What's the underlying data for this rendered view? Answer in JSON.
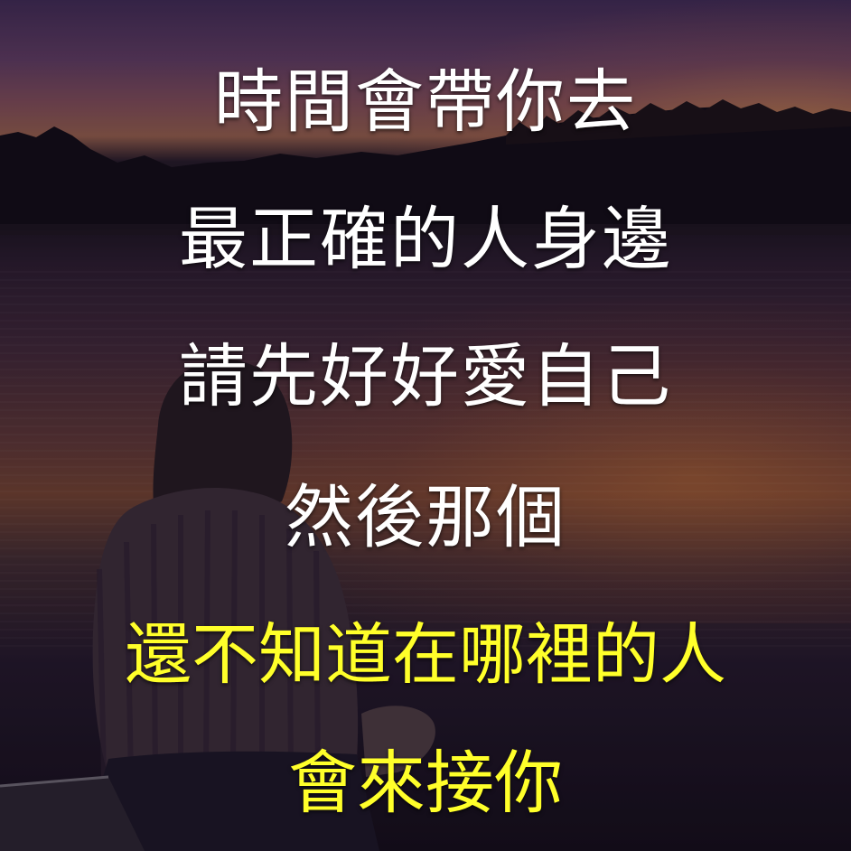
{
  "quote": {
    "lines": [
      {
        "text": "時間會帶你去",
        "color": "#ffffff"
      },
      {
        "text": "最正確的人身邊",
        "color": "#ffffff"
      },
      {
        "text": "請先好好愛自己",
        "color": "#ffffff"
      },
      {
        "text": "然後那個",
        "color": "#ffffff"
      },
      {
        "text": "還不知道在哪裡的人",
        "color": "#ffff2a"
      },
      {
        "text": "會來接你",
        "color": "#ffff2a"
      }
    ]
  },
  "scene": {
    "description_colors": {
      "sky": "#5b3a5e",
      "sunset": "#d69646",
      "water": "#6d4030",
      "shadow": "#120c1c"
    }
  }
}
